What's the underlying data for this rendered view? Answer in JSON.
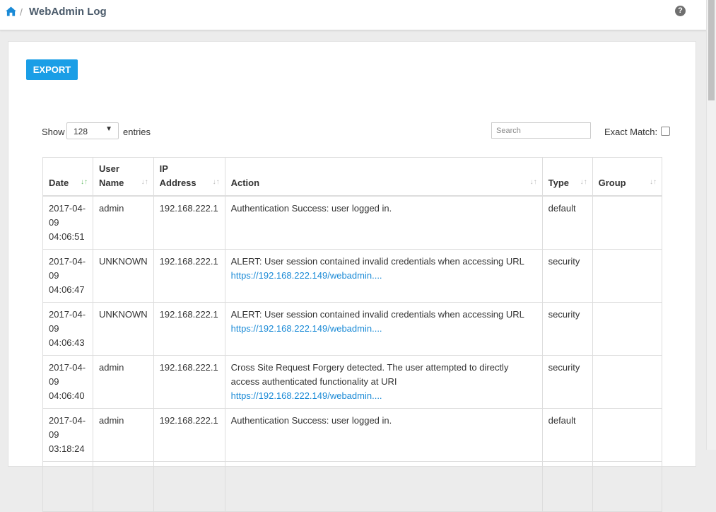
{
  "header": {
    "icons": {
      "home": "home-icon",
      "help": "question-circle-icon"
    },
    "separator": "/",
    "title": "WebAdmin Log",
    "help_glyph": "?"
  },
  "toolbar": {
    "export_label": "EXPORT"
  },
  "controls": {
    "show_label": "Show",
    "show_value": "128",
    "entries_label": "entries",
    "search_placeholder": "Search",
    "exact_match_label": "Exact Match:",
    "exact_match_checked": false
  },
  "table": {
    "columns": [
      {
        "line1": "Date",
        "line2": "",
        "sort": "desc"
      },
      {
        "line1": "User",
        "line2": "Name",
        "sort": "none"
      },
      {
        "line1": "IP",
        "line2": "Address",
        "sort": "none"
      },
      {
        "line1": "Action",
        "line2": "",
        "sort": "none"
      },
      {
        "line1": "Type",
        "line2": "",
        "sort": "none"
      },
      {
        "line1": "Group",
        "line2": "",
        "sort": "none"
      }
    ],
    "rows": [
      {
        "date": [
          "2017-04-",
          "09",
          "04:06:51"
        ],
        "user": "admin",
        "ip": "192.168.222.1",
        "action": [
          "Authentication Success: user logged in."
        ],
        "link": "",
        "type": "default",
        "group": ""
      },
      {
        "date": [
          "2017-04-",
          "09",
          "04:06:47"
        ],
        "user": "UNKNOWN",
        "ip": "192.168.222.1",
        "action": [
          "ALERT: User session contained invalid credentials when accessing URL"
        ],
        "link": "https://192.168.222.149/webadmin....",
        "type": "security",
        "group": ""
      },
      {
        "date": [
          "2017-04-",
          "09",
          "04:06:43"
        ],
        "user": "UNKNOWN",
        "ip": "192.168.222.1",
        "action": [
          "ALERT: User session contained invalid credentials when accessing URL"
        ],
        "link": "https://192.168.222.149/webadmin....",
        "type": "security",
        "group": ""
      },
      {
        "date": [
          "2017-04-",
          "09",
          "04:06:40"
        ],
        "user": "admin",
        "ip": "192.168.222.1",
        "action": [
          "Cross Site Request Forgery detected. The user attempted to directly",
          "access authenticated functionality at URI"
        ],
        "link": "https://192.168.222.149/webadmin....",
        "type": "security",
        "group": ""
      },
      {
        "date": [
          "2017-04-",
          "09",
          "03:18:24"
        ],
        "user": "admin",
        "ip": "192.168.222.1",
        "action": [
          "Authentication Success: user logged in."
        ],
        "link": "",
        "type": "default",
        "group": ""
      }
    ]
  },
  "colors": {
    "accent": "#1a9ee6",
    "link": "#1a8ad6",
    "sort_active": "#6cbf6c"
  }
}
